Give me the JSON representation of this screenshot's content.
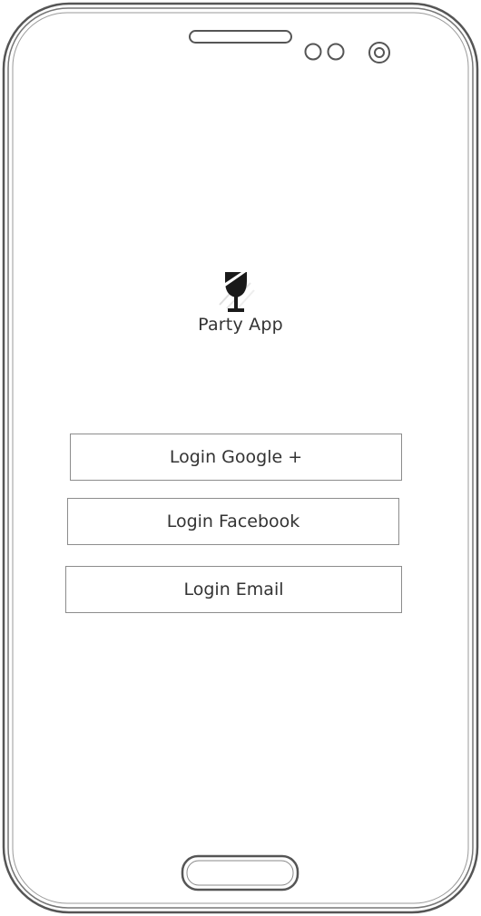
{
  "app": {
    "title": "Party App",
    "logo_icon": "wine-glass-icon"
  },
  "login": {
    "google_label": "Login Google +",
    "facebook_label": "Login Facebook",
    "email_label": "Login Email"
  },
  "device": {
    "frame_icon": "phone-frame",
    "speaker_icon": "speaker-grille-icon",
    "sensor_icon": "sensor-icon",
    "camera_icon": "camera-icon",
    "home_button_icon": "home-button-icon"
  },
  "colors": {
    "outline": "#555555",
    "text": "#333333",
    "button_border": "#8c8c8c"
  }
}
